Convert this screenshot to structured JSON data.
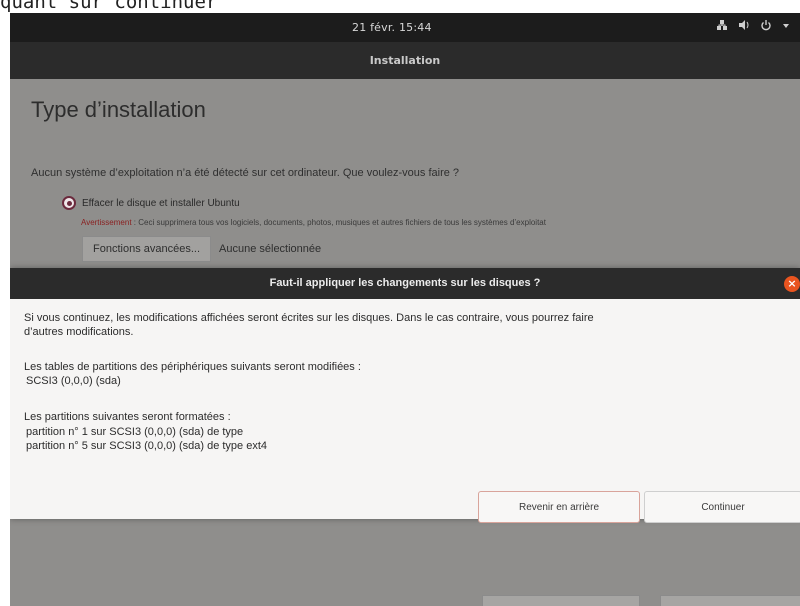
{
  "caption": "quant sur continuer",
  "topbar": {
    "clock": "21 févr. 15:44",
    "tray_icons": [
      "network-icon",
      "volume-icon",
      "power-icon",
      "chevron-down-icon"
    ]
  },
  "window": {
    "title": "Installation"
  },
  "installer": {
    "page_title": "Type d’installation",
    "question": "Aucun système d’exploitation n’a été détecté sur cet ordinateur. Que voulez-vous faire ?",
    "option_label": "Effacer le disque et installer Ubuntu",
    "warning_key": "Avertissement",
    "warning_text": " : Ceci supprimera tous vos logiciels, documents, photos, musiques et autres fichiers de tous les systèmes d’exploitat",
    "advanced_button": "Fonctions avancées...",
    "advanced_value": "Aucune sélectionnée"
  },
  "dialog": {
    "title": "Faut-il appliquer les changements sur les disques ?",
    "paragraph1_line1": "Si vous continuez, les modifications affichées seront écrites sur les disques. Dans le cas contraire, vous pourrez faire",
    "paragraph1_line2": "d’autres modifications.",
    "tables_intro": "Les tables de partitions des périphériques suivants seront modifiées :",
    "tables_item": "SCSI3 (0,0,0) (sda)",
    "format_intro": "Les partitions suivantes seront formatées :",
    "format_item1": "partition n° 1 sur SCSI3 (0,0,0) (sda) de type",
    "format_item2": "partition n° 5 sur SCSI3 (0,0,0) (sda) de type ext4",
    "back_button": "Revenir en arrière",
    "continue_button": "Continuer"
  },
  "colors": {
    "topbar": "#1c1c1c",
    "dialog_bg": "#f6f5f4",
    "close_accent": "#e9541f",
    "radio_accent": "#6b2a3d",
    "warning_red": "#8a1f1f"
  }
}
